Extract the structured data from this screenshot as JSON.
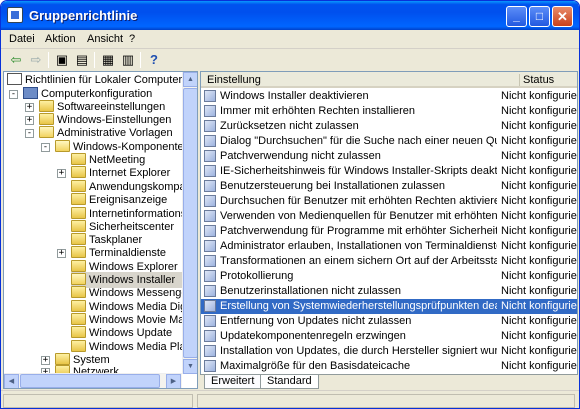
{
  "window": {
    "title": "Gruppenrichtlinie",
    "min_glyph": "_",
    "max_glyph": "□",
    "close_glyph": "✕"
  },
  "menu": [
    {
      "label": "Datei"
    },
    {
      "label": "Aktion"
    },
    {
      "label": "Ansicht"
    },
    {
      "label": "?"
    }
  ],
  "toolbar": {
    "back": "⇦",
    "forward": "⇨",
    "up": "▣",
    "showtree": "▤",
    "properties": "▦",
    "export": "▥",
    "help": "?"
  },
  "tree": [
    {
      "label": "Richtlinien für Lokaler Computer",
      "icon": "doc-icon"
    },
    {
      "label": "Computerkonfiguration",
      "icon": "computer-icon",
      "exp": "-"
    },
    {
      "label": "Softwareeinstellungen",
      "icon": "folder-icon",
      "exp": "+"
    },
    {
      "label": "Windows-Einstellungen",
      "icon": "folder-icon",
      "exp": "+"
    },
    {
      "label": "Administrative Vorlagen",
      "icon": "folder-icon",
      "exp": "-"
    },
    {
      "label": "Windows-Komponenten",
      "icon": "folder-icon",
      "exp": "-"
    },
    {
      "label": "NetMeeting",
      "icon": "folder-icon"
    },
    {
      "label": "Internet Explorer",
      "icon": "folder-icon",
      "exp": "+"
    },
    {
      "label": "Anwendungskompatibilit",
      "icon": "folder-icon"
    },
    {
      "label": "Ereignisanzeige",
      "icon": "folder-icon"
    },
    {
      "label": "Internetinformationsdier",
      "icon": "folder-icon"
    },
    {
      "label": "Sicherheitscenter",
      "icon": "folder-icon"
    },
    {
      "label": "Taskplaner",
      "icon": "folder-icon"
    },
    {
      "label": "Terminaldienste",
      "icon": "folder-icon",
      "exp": "+"
    },
    {
      "label": "Windows Explorer",
      "icon": "folder-icon"
    },
    {
      "label": "Windows Installer",
      "icon": "folder-icon",
      "selected": true
    },
    {
      "label": "Windows Messenger",
      "icon": "folder-icon"
    },
    {
      "label": "Windows Media Digital R",
      "icon": "folder-icon"
    },
    {
      "label": "Windows Movie Maker",
      "icon": "folder-icon"
    },
    {
      "label": "Windows Update",
      "icon": "folder-icon"
    },
    {
      "label": "Windows Media Player",
      "icon": "folder-icon"
    },
    {
      "label": "System",
      "icon": "folder-icon",
      "exp": "+"
    },
    {
      "label": "Netzwerk",
      "icon": "folder-icon",
      "exp": "+"
    }
  ],
  "list": {
    "col_setting": "Einstellung",
    "col_status": "Status",
    "rows": [
      {
        "name": "Windows Installer deaktivieren",
        "status": "Nicht konfiguriert"
      },
      {
        "name": "Immer mit erhöhten Rechten installieren",
        "status": "Nicht konfiguriert"
      },
      {
        "name": "Zurücksetzen nicht zulassen",
        "status": "Nicht konfiguriert"
      },
      {
        "name": "Dialog \"Durchsuchen\" für die Suche nach einer neuen Quelle entfer...",
        "status": "Nicht konfiguriert"
      },
      {
        "name": "Patchverwendung nicht zulassen",
        "status": "Nicht konfiguriert"
      },
      {
        "name": "IE-Sicherheitshinweis für Windows Installer-Skripts deaktivieren",
        "status": "Nicht konfiguriert"
      },
      {
        "name": "Benutzersteuerung bei Installationen zulassen",
        "status": "Nicht konfiguriert"
      },
      {
        "name": "Durchsuchen für Benutzer mit erhöhten Rechten aktivieren",
        "status": "Nicht konfiguriert"
      },
      {
        "name": "Verwenden von Medienquellen für Benutzer mit erhöhten Rechten...",
        "status": "Nicht konfiguriert"
      },
      {
        "name": "Patchverwendung für Programme mit erhöhter Sicherheit zulassen",
        "status": "Nicht konfiguriert"
      },
      {
        "name": "Administrator erlauben, Installationen von Terminaldienstesitzung...",
        "status": "Nicht konfiguriert"
      },
      {
        "name": "Transformationen an einem sichern Ort auf der Arbeitsstation zwi...",
        "status": "Nicht konfiguriert"
      },
      {
        "name": "Protokollierung",
        "status": "Nicht konfiguriert"
      },
      {
        "name": "Benutzerinstallationen nicht zulassen",
        "status": "Nicht konfiguriert"
      },
      {
        "name": "Erstellung von Systemwiederherstellungsprüfpunkten deaktivieren",
        "status": "Nicht konfiguriert",
        "selected": true
      },
      {
        "name": "Entfernung von Updates nicht zulassen",
        "status": "Nicht konfiguriert"
      },
      {
        "name": "Updatekomponentenregeln erzwingen",
        "status": "Nicht konfiguriert"
      },
      {
        "name": "Installation von Updates, die durch Hersteller signiert wurden, für...",
        "status": "Nicht konfiguriert"
      },
      {
        "name": "Maximalgröße für den Basisdateicache",
        "status": "Nicht konfiguriert"
      }
    ]
  },
  "tabs": [
    {
      "label": "Erweitert"
    },
    {
      "label": "Standard"
    }
  ],
  "scroll": {
    "up": "▲",
    "down": "▼",
    "left": "◀",
    "right": "▶"
  }
}
